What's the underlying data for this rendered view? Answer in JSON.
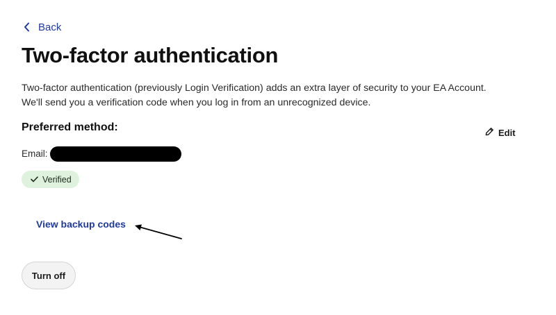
{
  "nav": {
    "back_label": "Back"
  },
  "page": {
    "title": "Two-factor authentication",
    "description_line1": "Two-factor authentication (previously Login Verification) adds an extra layer of security to your EA Account.",
    "description_line2": "We'll send you a verification code when you log in from an unrecognized device."
  },
  "method": {
    "heading": "Preferred method:",
    "edit_label": "Edit",
    "email_label": "Email:",
    "status": "Verified"
  },
  "actions": {
    "backup_codes_label": "View backup codes",
    "turn_off_label": "Turn off"
  },
  "icons": {
    "back": "chevron-left-icon",
    "edit": "pencil-icon",
    "verified": "checkmark-icon",
    "annotation": "arrow-icon"
  },
  "colors": {
    "link": "#1f3a9e",
    "badge_bg": "#dff2de",
    "button_bg": "#f3f3f3"
  }
}
